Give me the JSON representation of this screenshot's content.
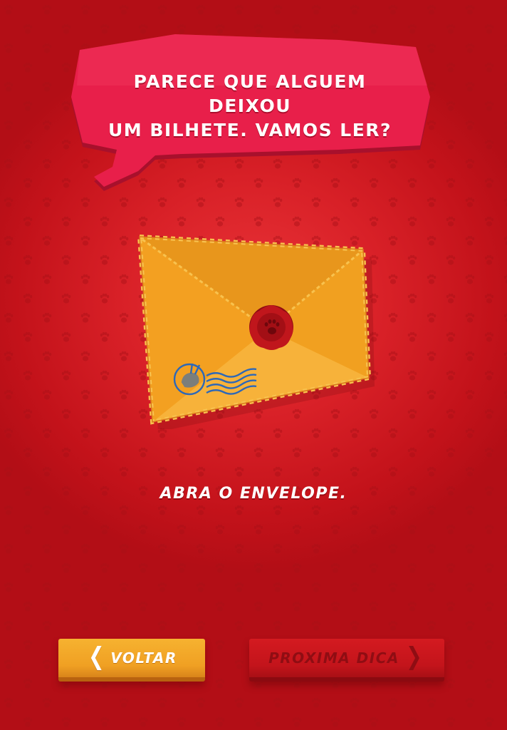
{
  "bubble": {
    "line1": "PARECE QUE ALGUEM DEIXOU",
    "line2": "UM BILHETE. VAMOS LER?"
  },
  "envelope": {
    "icon": "envelope-icon",
    "seal_icon": "paw-print-icon",
    "stamp_icon": "rabbit-stamp-icon"
  },
  "instruction": "ABRA O ENVELOPE.",
  "buttons": {
    "back_label": "VOLTAR",
    "back_icon": "chevron-left-icon",
    "next_label": "PROXIMA DICA",
    "next_icon": "chevron-right-icon"
  },
  "colors": {
    "background": "#d82027",
    "bubble": "#e81f4a",
    "envelope": "#f5a623",
    "seal": "#b8151a",
    "stamp": "#2d68b8",
    "back_button": "#f0a023",
    "next_button": "#c3141b"
  }
}
